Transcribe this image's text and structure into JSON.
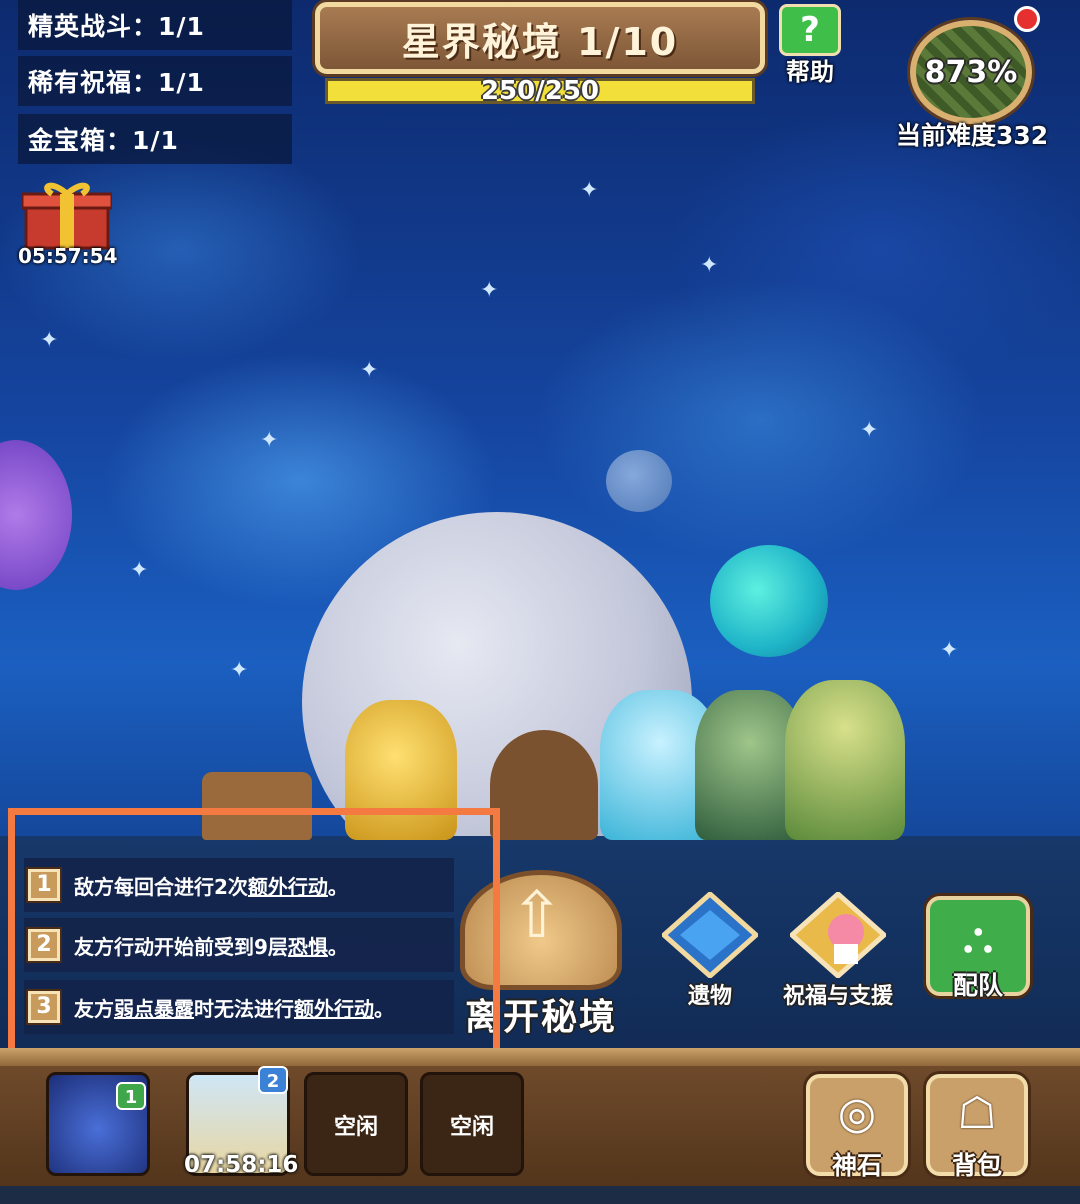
{
  "counters": [
    "精英战斗：1/1",
    "稀有祝福：1/1",
    "金宝箱：1/1"
  ],
  "gift": {
    "timer": "05:57:54"
  },
  "header": {
    "title": "星界秘境 1/10",
    "progress_text": "250/250",
    "progress_fraction": 1.0,
    "help_label": "帮助"
  },
  "difficulty": {
    "percent": "873%",
    "label": "当前难度332"
  },
  "modifiers": [
    {
      "num": "1",
      "pre": "敌方每回合进行2次",
      "link": "额外行动",
      "post": "。",
      "link2": "",
      "post2": ""
    },
    {
      "num": "2",
      "pre": "友方行动开始前受到9层",
      "link": "恐惧",
      "post": "。",
      "link2": "",
      "post2": ""
    },
    {
      "num": "3",
      "pre": "友方",
      "link": "弱点暴露",
      "post": "时无法进行",
      "link2": "额外行动",
      "post2": "。"
    }
  ],
  "actions": {
    "leave": "离开秘境",
    "relics": "遗物",
    "blessings": "祝福与支援",
    "team": "配队"
  },
  "bottom": {
    "slots": [
      {
        "label": "",
        "badge": "1",
        "badge_color": "#3fa64a"
      },
      {
        "label": "",
        "badge": "2",
        "badge_color": "#3b82d6",
        "timer": "07:58:16"
      },
      {
        "label": "空闲"
      },
      {
        "label": "空闲"
      }
    ],
    "god_stone": "神石",
    "backpack": "背包"
  },
  "colors": {
    "highlight": "#f47a42",
    "progress": "#f7e640"
  }
}
